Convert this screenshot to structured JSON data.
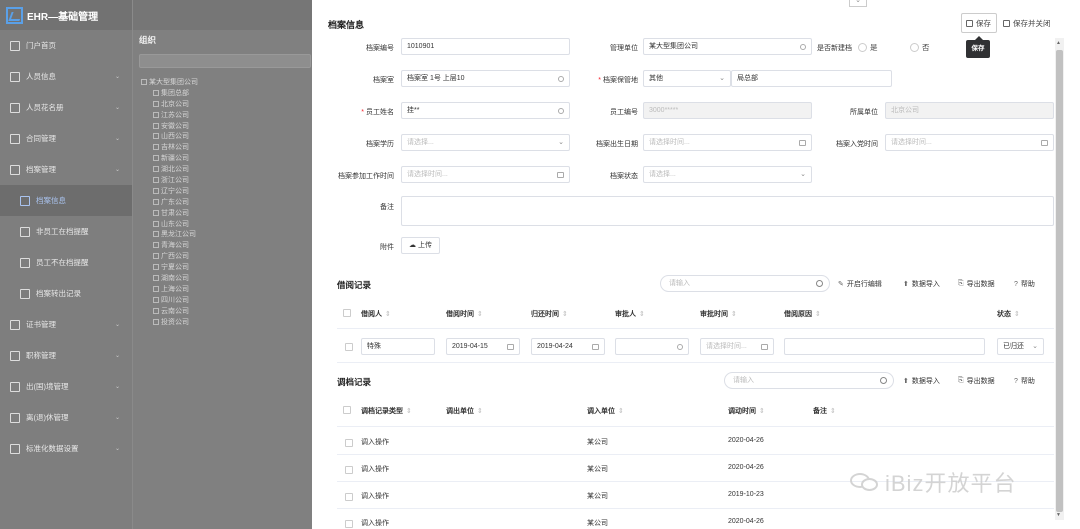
{
  "app": {
    "title": "EHR—基础管理"
  },
  "sidebar": {
    "items": [
      {
        "label": "门户首页",
        "icon": "home-icon"
      },
      {
        "label": "人员信息",
        "icon": "person-card-icon"
      },
      {
        "label": "人员花名册",
        "icon": "people-icon"
      },
      {
        "label": "合同管理",
        "icon": "contract-icon"
      },
      {
        "label": "档案管理",
        "icon": "archive-icon"
      },
      {
        "label": "档案信息",
        "icon": "archive-info-icon",
        "active": true
      },
      {
        "label": "非员工在档提醒",
        "icon": "doc-icon"
      },
      {
        "label": "员工不在档提醒",
        "icon": "doc-icon"
      },
      {
        "label": "档案转出记录",
        "icon": "doc-icon"
      },
      {
        "label": "证书管理",
        "icon": "certificate-icon"
      },
      {
        "label": "职称管理",
        "icon": "title-icon"
      },
      {
        "label": "出(国)境管理",
        "icon": "plane-icon"
      },
      {
        "label": "离(退)休管理",
        "icon": "retire-icon"
      },
      {
        "label": "标准化数据设置",
        "icon": "settings-icon"
      }
    ]
  },
  "tree": {
    "title": "组织",
    "root": "某大型集团公司",
    "children": [
      "集团总部",
      "北京公司",
      "江苏公司",
      "安徽公司",
      "山西公司",
      "吉林公司",
      "新疆公司",
      "湖北公司",
      "浙江公司",
      "辽宁公司",
      "广东公司",
      "甘肃公司",
      "山东公司",
      "黑龙江公司",
      "青海公司",
      "广西公司",
      "宁夏公司",
      "湖南公司",
      "上海公司",
      "四川公司",
      "云南公司",
      "投资公司"
    ]
  },
  "form": {
    "section_title": "档案信息",
    "save_label": "保存",
    "save_close_label": "保存并关闭",
    "save_tooltip": "保存",
    "fields": {
      "archive_no_label": "档案编号",
      "archive_no_value": "1010901",
      "mgmt_unit_label": "管理单位",
      "mgmt_unit_value": "某大型集团公司",
      "is_new_label": "是否新建档",
      "yes_label": "是",
      "no_label": "否",
      "archive_room_label": "档案室",
      "archive_room_value": "档案室 1号 上层10",
      "keeper_label": "档案保管地",
      "keeper_value": "其他",
      "keeper_extra_value": "局总部",
      "emp_name_label": "员工姓名",
      "emp_name_value": "挂**",
      "emp_no_label": "员工编号",
      "emp_no_value": "3000*****",
      "unit_label": "所属单位",
      "unit_value": "北京公司",
      "edu_label": "档案学历",
      "edu_placeholder": "请选择...",
      "birth_label": "档案出生日期",
      "birth_placeholder": "请选择时间...",
      "party_label": "档案入党时间",
      "party_placeholder": "请选择时间...",
      "work_label": "档案参加工作时间",
      "work_placeholder": "请选择时间...",
      "status_label": "档案状态",
      "status_placeholder": "请选择...",
      "remark_label": "备注",
      "attach_label": "附件",
      "upload_label": "上传"
    }
  },
  "borrow": {
    "title": "借阅记录",
    "search_placeholder": "请输入",
    "tools": {
      "inline_edit": "开启行编辑",
      "import": "数据导入",
      "export": "导出数据",
      "help": "帮助"
    },
    "columns": [
      "借阅人",
      "借阅时间",
      "归还时间",
      "审批人",
      "审批时间",
      "借阅原因",
      "状态"
    ],
    "row": {
      "borrower": "特殊",
      "borrow_date": "2019-04-15",
      "return_date": "2019-04-24",
      "approver": "",
      "approve_time_placeholder": "请选择时间...",
      "reason": "",
      "status": "已归还"
    }
  },
  "transfer": {
    "title": "调档记录",
    "search_placeholder": "请输入",
    "tools": {
      "import": "数据导入",
      "export": "导出数据",
      "help": "帮助"
    },
    "columns": [
      "调档记录类型",
      "调出单位",
      "调入单位",
      "调动时间",
      "备注"
    ],
    "rows": [
      {
        "type": "调入操作",
        "out": "",
        "in": "某公司",
        "date": "2020-04-26",
        "remark": ""
      },
      {
        "type": "调入操作",
        "out": "",
        "in": "某公司",
        "date": "2020-04-26",
        "remark": ""
      },
      {
        "type": "调入操作",
        "out": "",
        "in": "某公司",
        "date": "2019-10-23",
        "remark": ""
      },
      {
        "type": "调入操作",
        "out": "",
        "in": "某公司",
        "date": "2020-04-26",
        "remark": ""
      }
    ]
  },
  "watermark": {
    "text": "iBiz开放平台"
  }
}
